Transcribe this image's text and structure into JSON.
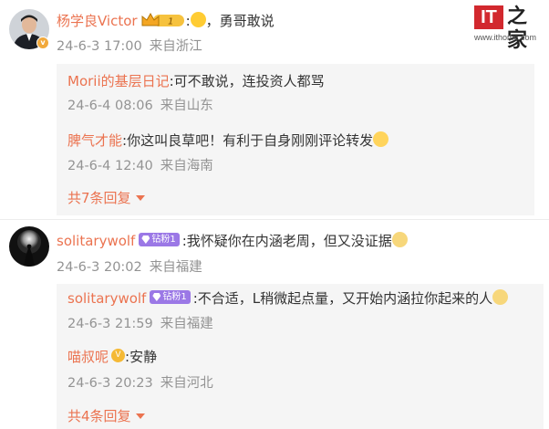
{
  "watermark": {
    "logo_text": "IT",
    "logo_cn": "之家",
    "url": "www.ithome.com"
  },
  "comments": [
    {
      "user": "杨学良Victor",
      "crown_level": "1",
      "sep": ":",
      "text": "，勇哥敢说",
      "emoji": "grinning-face",
      "date": "24-6-3 17:00",
      "location": "来自浙江",
      "replies": [
        {
          "user": "Morii的基层日记",
          "text": ":可不敢说，连投资人都骂",
          "date": "24-6-4 08:06",
          "location": "来自山东"
        },
        {
          "user": "脾气才能",
          "text": ":你这叫良草吧！有利于自身刚刚评论转发",
          "emoji": "shushing-face",
          "date": "24-6-4 12:40",
          "location": "来自海南"
        }
      ],
      "more_replies": "共7条回复"
    },
    {
      "user": "solitarywolf",
      "fan_badge": "钻粉1",
      "text": ":我怀疑你在内涵老周，但又没证据",
      "emoji": "cat-face",
      "date": "24-6-3 20:02",
      "location": "来自福建",
      "replies": [
        {
          "user": "solitarywolf",
          "fan_badge": "钻粉1",
          "text": ":不合适，L稍微起点量，又开始内涵拉你起来的人",
          "emoji": "cat-face",
          "date": "24-6-3 21:59",
          "location": "来自福建"
        },
        {
          "user": "喵叔呢",
          "vip": "V",
          "text": ":安静",
          "date": "24-6-3 20:23",
          "location": "来自河北"
        }
      ],
      "more_replies": "共4条回复"
    }
  ]
}
